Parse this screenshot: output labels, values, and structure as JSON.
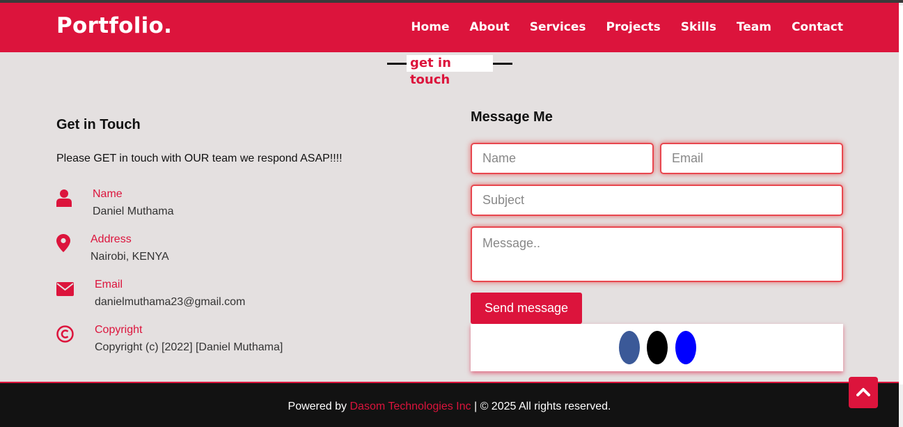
{
  "brand": "Portfolio.",
  "nav": {
    "home": "Home",
    "about": "About",
    "services": "Services",
    "projects": "Projects",
    "skills": "Skills",
    "team": "Team",
    "contact": "Contact"
  },
  "section": {
    "heading": "get in touch"
  },
  "contact_info": {
    "title": "Get in Touch",
    "description": "Please GET in touch with OUR team we respond ASAP!!!!",
    "items": [
      {
        "icon": "user-icon",
        "label": "Name",
        "value": "Daniel Muthama"
      },
      {
        "icon": "map-marker-icon",
        "label": "Address",
        "value": "Nairobi, KENYA"
      },
      {
        "icon": "envelope-icon",
        "label": "Email",
        "value": "danielmuthama23@gmail.com"
      },
      {
        "icon": "copyright-icon",
        "label": "Copyright",
        "value": "Copyright (c) [2022] [Daniel Muthama]"
      }
    ]
  },
  "form": {
    "title": "Message Me",
    "name_placeholder": "Name",
    "email_placeholder": "Email",
    "subject_placeholder": "Subject",
    "message_placeholder": "Message..",
    "submit_label": "Send message"
  },
  "social": {
    "icons": [
      "facebook-icon",
      "github-icon",
      "linkedin-icon"
    ],
    "colors": [
      "#3b5998",
      "#000000",
      "#0000ff"
    ]
  },
  "footer": {
    "prefix": "Powered by",
    "company": "Dasom Technologies Inc",
    "suffix": "| © 2025 All rights reserved."
  },
  "colors": {
    "accent": "#dc143c",
    "background": "#e4e0e0",
    "footer_bg": "#121212"
  },
  "back_to_top_icon": "chevron-up-icon"
}
